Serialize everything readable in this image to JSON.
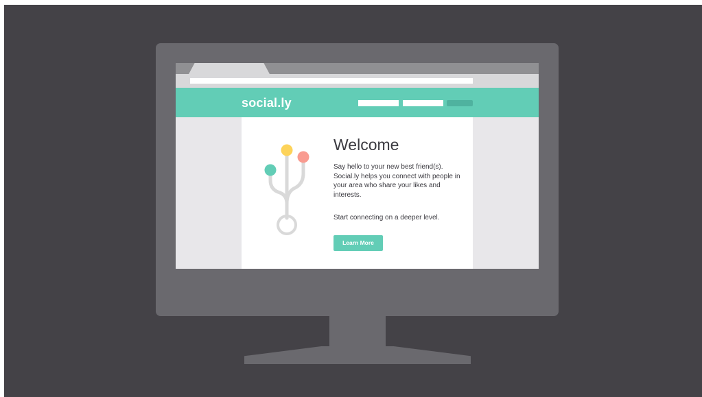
{
  "site": {
    "logo": "social.ly",
    "nav_links": [
      "",
      ""
    ],
    "nav_button": ""
  },
  "browser": {
    "address": "",
    "tab_title": ""
  },
  "hero": {
    "title": "Welcome",
    "intro": "Say hello to your new best friend(s). Social.ly helps you connect with people in your area who share your likes and interests.",
    "cta_text": "Start connecting on a deeper level.",
    "button_label": "Learn More"
  },
  "illustration": {
    "node_colors": [
      "#62cdb6",
      "#fdd35a",
      "#f99b90"
    ],
    "stem_color": "#d9d9d9"
  },
  "colors": {
    "brand": "#62cdb6",
    "background": "#444247",
    "device": "#6a696e",
    "text": "#3b3a40"
  }
}
